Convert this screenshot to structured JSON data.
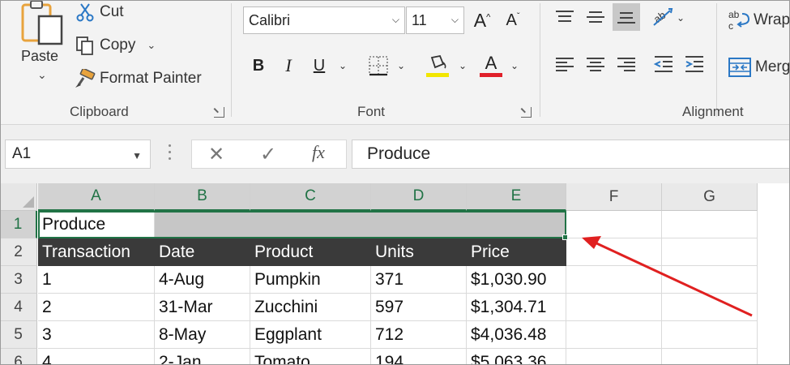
{
  "ribbon": {
    "clipboard": {
      "paste_label": "Paste",
      "cut_label": "Cut",
      "copy_label": "Copy",
      "format_painter_label": "Format Painter",
      "group_label": "Clipboard"
    },
    "font": {
      "font_name": "Calibri",
      "font_size": "11",
      "group_label": "Font",
      "highlight_color": "#f2e600",
      "font_color": "#e0202a"
    },
    "alignment": {
      "wrap_label": "Wrap",
      "merge_label": "Merg",
      "group_label": "Alignment"
    }
  },
  "formula_bar": {
    "name_box": "A1",
    "fx_label": "fx",
    "formula": "Produce"
  },
  "grid": {
    "columns": [
      "A",
      "B",
      "C",
      "D",
      "E",
      "F",
      "G"
    ],
    "rows": [
      "1",
      "2",
      "3",
      "4",
      "5",
      "6"
    ],
    "cells": [
      [
        "Produce",
        "",
        "",
        "",
        ""
      ],
      [
        "Transaction",
        "Date",
        "Product",
        "Units",
        "Price"
      ],
      [
        "1",
        "4-Aug",
        "Pumpkin",
        "371",
        "$1,030.90"
      ],
      [
        "2",
        "31-Mar",
        "Zucchini",
        "597",
        "$1,304.71"
      ],
      [
        "3",
        "8-May",
        "Eggplant",
        "712",
        "$4,036.48"
      ],
      [
        "4",
        "2-Jan",
        "Tomato",
        "194",
        "$5,063.36"
      ]
    ],
    "selection_color": "#217346",
    "header_row_color": "#3a3a3a",
    "annotation_arrow_color": "#e02020"
  }
}
